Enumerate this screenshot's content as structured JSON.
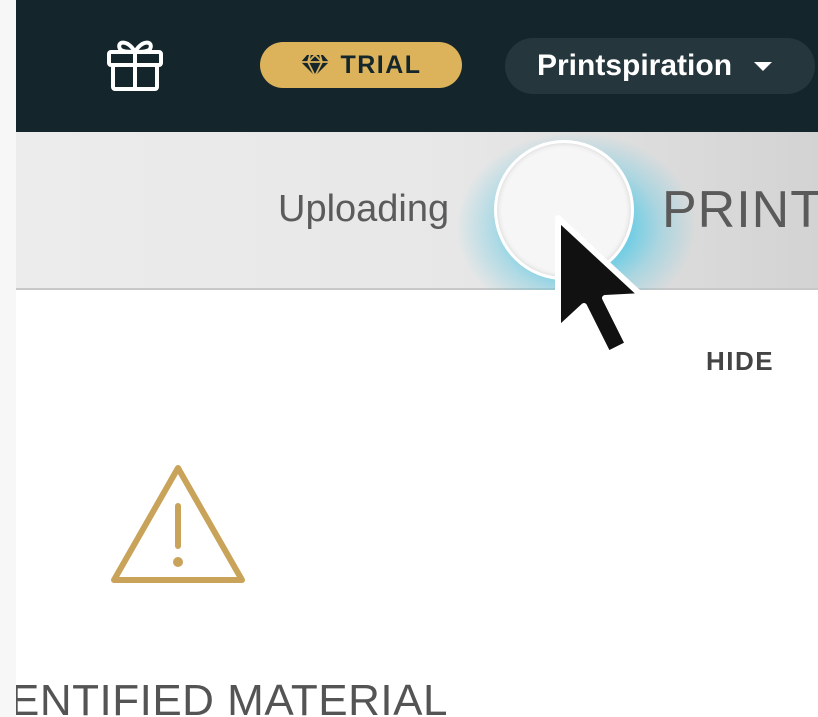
{
  "header": {
    "trial_badge": "TRIAL",
    "account_name": "Printspiration",
    "icons": [
      "gift-icon",
      "diamond-icon",
      "caret-down-icon"
    ]
  },
  "print_toggle": {
    "left_label": "Uploading",
    "right_label": "PRINT"
  },
  "panel": {
    "hide_label": "HIDE",
    "warning_icon": "warning-triangle-icon",
    "title": "ENTIFIED MATERIAL"
  },
  "colors": {
    "topbar": "#14262b",
    "trial_badge": "#dcb25a",
    "account_pill": "#25373c",
    "toggle_glow": "#50c8e6",
    "warning": "#c9a35a"
  }
}
